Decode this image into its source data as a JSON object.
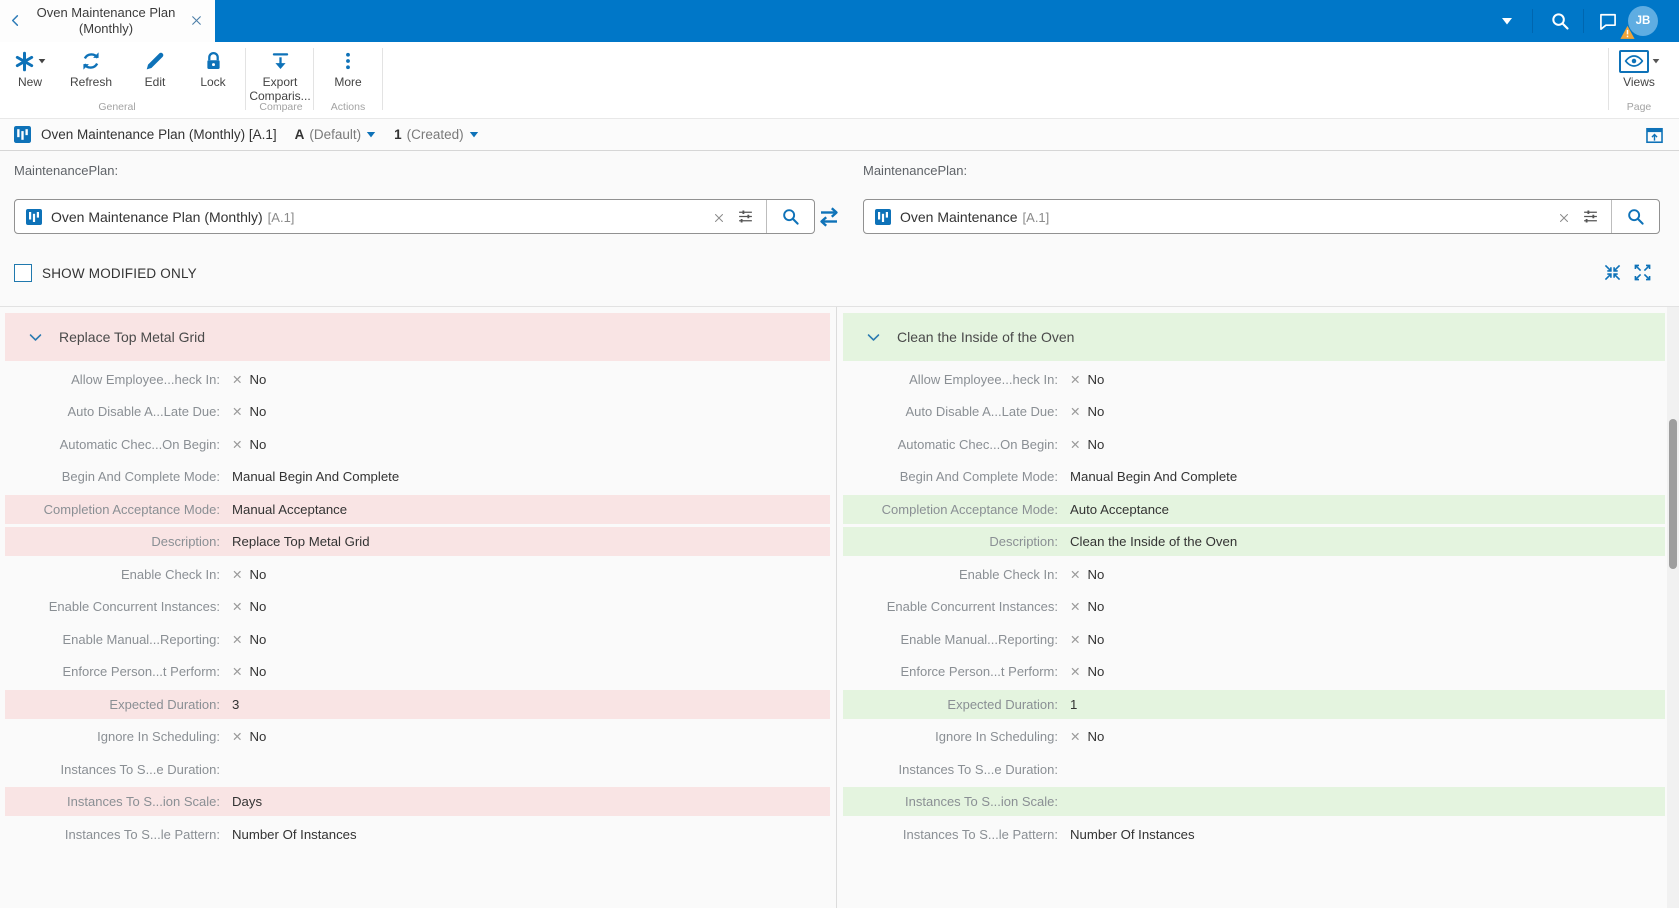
{
  "tab": {
    "title": "Oven Maintenance Plan (Monthly)"
  },
  "topbar": {
    "avatar_initials": "JB"
  },
  "ribbon": {
    "buttons": {
      "new": "New",
      "refresh": "Refresh",
      "edit": "Edit",
      "lock": "Lock",
      "export": "Export Comparis...",
      "more": "More",
      "views": "Views"
    },
    "groups": {
      "general": "General",
      "compare": "Compare",
      "actions": "Actions",
      "page": "Page"
    }
  },
  "breadcrumb": {
    "title": "Oven Maintenance Plan (Monthly) [A.1]",
    "revision": "A",
    "revision_state": "(Default)",
    "version": "1",
    "version_state": "(Created)"
  },
  "compare": {
    "show_modified_label": "SHOW MODIFIED ONLY",
    "left": {
      "field_label": "MaintenancePlan:",
      "input_value": "Oven Maintenance Plan (Monthly)",
      "input_ref": "[A.1]",
      "section_title": "Replace Top Metal Grid",
      "rows": [
        {
          "label": "Allow Employee...heck In:",
          "value": "No",
          "no": true,
          "changed": false
        },
        {
          "label": "Auto Disable A...Late Due:",
          "value": "No",
          "no": true,
          "changed": false
        },
        {
          "label": "Automatic Chec...On Begin:",
          "value": "No",
          "no": true,
          "changed": false
        },
        {
          "label": "Begin And Complete Mode:",
          "value": "Manual Begin And Complete",
          "no": false,
          "changed": false
        },
        {
          "label": "Completion Acceptance Mode:",
          "value": "Manual Acceptance",
          "no": false,
          "changed": true
        },
        {
          "label": "Description:",
          "value": "Replace Top Metal Grid",
          "no": false,
          "changed": true
        },
        {
          "label": "Enable Check In:",
          "value": "No",
          "no": true,
          "changed": false
        },
        {
          "label": "Enable Concurrent Instances:",
          "value": "No",
          "no": true,
          "changed": false
        },
        {
          "label": "Enable Manual...Reporting:",
          "value": "No",
          "no": true,
          "changed": false
        },
        {
          "label": "Enforce Person...t Perform:",
          "value": "No",
          "no": true,
          "changed": false
        },
        {
          "label": "Expected Duration:",
          "value": "3",
          "no": false,
          "changed": true
        },
        {
          "label": "Ignore In Scheduling:",
          "value": "No",
          "no": true,
          "changed": false
        },
        {
          "label": "Instances To S...e Duration:",
          "value": "",
          "no": false,
          "changed": false
        },
        {
          "label": "Instances To S...ion Scale:",
          "value": "Days",
          "no": false,
          "changed": true
        },
        {
          "label": "Instances To S...le Pattern:",
          "value": "Number Of Instances",
          "no": false,
          "changed": false
        }
      ]
    },
    "right": {
      "field_label": "MaintenancePlan:",
      "input_value": "Oven Maintenance",
      "input_ref": "[A.1]",
      "section_title": "Clean the Inside of the Oven",
      "rows": [
        {
          "label": "Allow Employee...heck In:",
          "value": "No",
          "no": true,
          "changed": false
        },
        {
          "label": "Auto Disable A...Late Due:",
          "value": "No",
          "no": true,
          "changed": false
        },
        {
          "label": "Automatic Chec...On Begin:",
          "value": "No",
          "no": true,
          "changed": false
        },
        {
          "label": "Begin And Complete Mode:",
          "value": "Manual Begin And Complete",
          "no": false,
          "changed": false
        },
        {
          "label": "Completion Acceptance Mode:",
          "value": "Auto Acceptance",
          "no": false,
          "changed": true
        },
        {
          "label": "Description:",
          "value": "Clean the Inside of the Oven",
          "no": false,
          "changed": true
        },
        {
          "label": "Enable Check In:",
          "value": "No",
          "no": true,
          "changed": false
        },
        {
          "label": "Enable Concurrent Instances:",
          "value": "No",
          "no": true,
          "changed": false
        },
        {
          "label": "Enable Manual...Reporting:",
          "value": "No",
          "no": true,
          "changed": false
        },
        {
          "label": "Enforce Person...t Perform:",
          "value": "No",
          "no": true,
          "changed": false
        },
        {
          "label": "Expected Duration:",
          "value": "1",
          "no": false,
          "changed": true
        },
        {
          "label": "Ignore In Scheduling:",
          "value": "No",
          "no": true,
          "changed": false
        },
        {
          "label": "Instances To S...e Duration:",
          "value": "",
          "no": false,
          "changed": false
        },
        {
          "label": "Instances To S...ion Scale:",
          "value": "",
          "no": false,
          "changed": true
        },
        {
          "label": "Instances To S...le Pattern:",
          "value": "Number Of Instances",
          "no": false,
          "changed": false
        }
      ]
    }
  },
  "colors": {
    "topbar_blue": "#0077c8",
    "icon_blue": "#0e72b8",
    "removed_bg": "#f9e4e4",
    "added_bg": "#e4f4df"
  }
}
